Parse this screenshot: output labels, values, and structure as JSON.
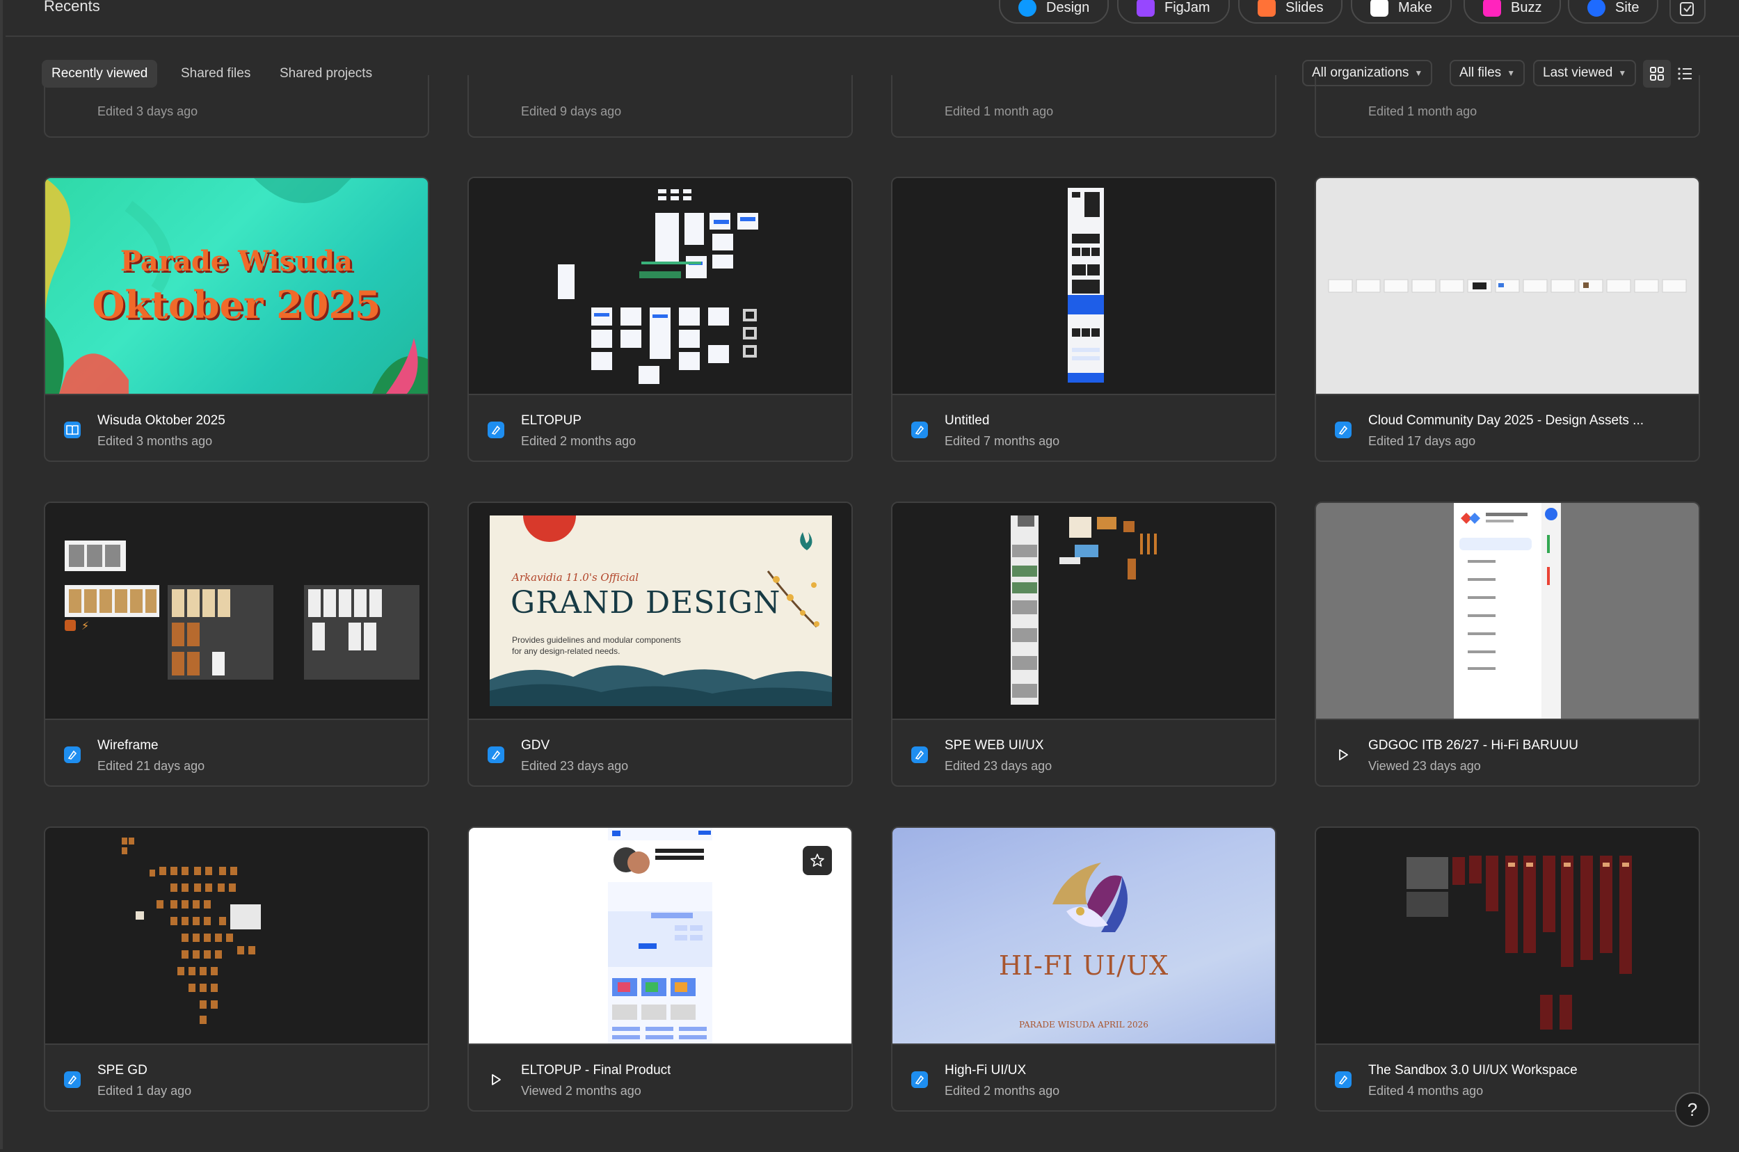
{
  "header": {
    "title": "Recents",
    "products": [
      {
        "label": "Design",
        "color": "#0d99ff"
      },
      {
        "label": "FigJam",
        "color": "#9747ff"
      },
      {
        "label": "Slides",
        "color": "#ff7237"
      },
      {
        "label": "Make",
        "color": "#ffffff"
      },
      {
        "label": "Buzz",
        "color": "#ff24bd"
      },
      {
        "label": "Site",
        "color": "#1e6bff"
      }
    ]
  },
  "tabs": [
    "Recently viewed",
    "Shared files",
    "Shared projects"
  ],
  "filters": {
    "organizations": "All organizations",
    "files": "All files",
    "sort": "Last viewed"
  },
  "partial_row": [
    "Edited 3 days ago",
    "Edited 9 days ago",
    "Edited 1 month ago",
    "Edited 1 month ago"
  ],
  "files": [
    {
      "name": "Wisuda Oktober 2025",
      "sub": "Edited 3 months ago",
      "icon": "book-icon"
    },
    {
      "name": "ELTOPUP",
      "sub": "Edited 2 months ago",
      "icon": "design-file-icon"
    },
    {
      "name": "Untitled",
      "sub": "Edited 7 months ago",
      "icon": "design-file-icon"
    },
    {
      "name": "Cloud Community Day 2025 - Design Assets ...",
      "sub": "Edited 17 days ago",
      "icon": "design-file-icon"
    },
    {
      "name": "Wireframe",
      "sub": "Edited 21 days ago",
      "icon": "design-file-icon"
    },
    {
      "name": "GDV",
      "sub": "Edited 23 days ago",
      "icon": "design-file-icon"
    },
    {
      "name": "SPE WEB UI/UX",
      "sub": "Edited 23 days ago",
      "icon": "design-file-icon"
    },
    {
      "name": "GDGOC ITB 26/27 - Hi-Fi BARUUU",
      "sub": "Viewed 23 days ago",
      "icon": "play-icon"
    },
    {
      "name": "SPE GD",
      "sub": "Edited 1 day ago",
      "icon": "design-file-icon"
    },
    {
      "name": "ELTOPUP - Final Product",
      "sub": "Viewed 2 months ago",
      "icon": "play-icon"
    },
    {
      "name": "High-Fi UI/UX",
      "sub": "Edited 2 months ago",
      "icon": "design-file-icon"
    },
    {
      "name": "The Sandbox 3.0 UI/UX Workspace",
      "sub": "Edited 4 months ago",
      "icon": "design-file-icon"
    }
  ],
  "thumbs": {
    "wisuda": {
      "line1": "Parade Wisuda",
      "line2": "Oktober 2025"
    },
    "gdv": {
      "eyebrow": "Arkavidia 11.0's Official",
      "title": "GRAND DESIGN",
      "desc1": "Provides guidelines and modular components",
      "desc2": "for any design-related needs."
    },
    "hifi": {
      "title": "HI-FI UI/UX",
      "sub": "PARADE WISUDA APRIL 2026"
    }
  },
  "help": "?"
}
